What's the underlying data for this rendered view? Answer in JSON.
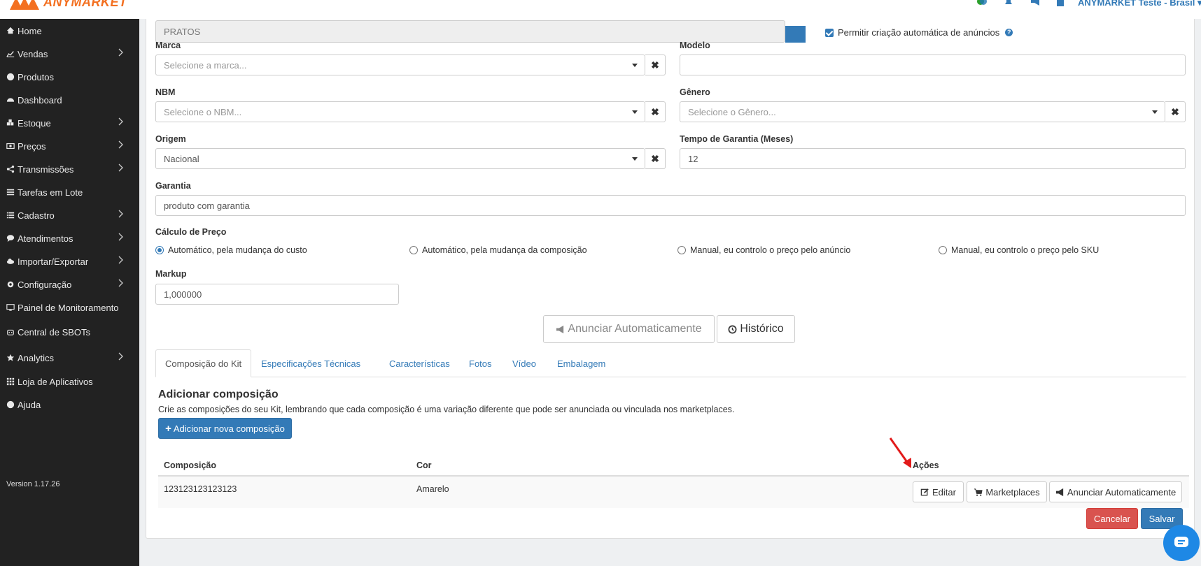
{
  "header": {
    "logo_text": "ANYMARKET",
    "account": "ANYMARKET Teste - Brasil"
  },
  "sidebar": {
    "items": [
      {
        "label": "Home",
        "icon": "home-icon",
        "has_submenu": false
      },
      {
        "label": "Vendas",
        "icon": "chart-line-icon",
        "has_submenu": true
      },
      {
        "label": "Produtos",
        "icon": "product-hunt-icon",
        "has_submenu": false
      },
      {
        "label": "Dashboard",
        "icon": "dashboard-icon",
        "has_submenu": false
      },
      {
        "label": "Estoque",
        "icon": "cubes-icon",
        "has_submenu": true
      },
      {
        "label": "Preços",
        "icon": "money-icon",
        "has_submenu": true
      },
      {
        "label": "Transmissões",
        "icon": "share-icon",
        "has_submenu": true
      },
      {
        "label": "Tarefas em Lote",
        "icon": "tasks-icon",
        "has_submenu": false
      },
      {
        "label": "Cadastro",
        "icon": "list-icon",
        "has_submenu": true
      },
      {
        "label": "Atendimentos",
        "icon": "comment-icon",
        "has_submenu": true
      },
      {
        "label": "Importar/Exportar",
        "icon": "cloud-icon",
        "has_submenu": true
      },
      {
        "label": "Configuração",
        "icon": "gear-icon",
        "has_submenu": true
      },
      {
        "label": "Painel de Monitoramento",
        "icon": "monitor-icon",
        "has_submenu": false
      },
      {
        "label": "Central de SBOTs",
        "icon": "robot-icon",
        "has_submenu": false
      },
      {
        "label": "Analytics",
        "icon": "star-icon",
        "has_submenu": true
      },
      {
        "label": "Loja de Aplicativos",
        "icon": "grid-icon",
        "has_submenu": false
      },
      {
        "label": "Ajuda",
        "icon": "question-icon",
        "has_submenu": false
      }
    ],
    "version": "Version 1.17.26"
  },
  "form": {
    "top_field_value": "PRATOS",
    "auto_ads_checkbox_label": "Permitir criação automática de anúncios",
    "marca": {
      "label": "Marca",
      "placeholder": "Selecione a marca..."
    },
    "modelo": {
      "label": "Modelo",
      "value": ""
    },
    "nbm": {
      "label": "NBM",
      "placeholder": "Selecione o NBM..."
    },
    "genero": {
      "label": "Gênero",
      "placeholder": "Selecione o Gênero..."
    },
    "origem": {
      "label": "Origem",
      "value": "Nacional"
    },
    "garantia_tempo": {
      "label": "Tempo de Garantia (Meses)",
      "value": "12"
    },
    "garantia": {
      "label": "Garantia",
      "value": "produto com garantia"
    },
    "calculo_preco": {
      "label": "Cálculo de Preço",
      "options": [
        "Automático, pela mudança do custo",
        "Automático, pela mudança da composição",
        "Manual, eu controlo o preço pelo anúncio",
        "Manual, eu controlo o preço pelo SKU"
      ],
      "selected_index": 0
    },
    "markup": {
      "label": "Markup",
      "value": "1,000000"
    }
  },
  "actions": {
    "anunciar": "Anunciar Automaticamente",
    "historico": "Histórico"
  },
  "tabs": [
    "Composição do Kit",
    "Especificações Técnicas",
    "Características",
    "Fotos",
    "Vídeo",
    "Embalagem"
  ],
  "composicao": {
    "title": "Adicionar composição",
    "description": "Crie as composições do seu Kit, lembrando que cada composição é uma variação diferente que pode ser anunciada ou vinculada nos marketplaces.",
    "add_button": "Adicionar nova composição",
    "columns": [
      "Composição",
      "Cor",
      "Ações"
    ],
    "rows": [
      {
        "composicao": "123123123123123",
        "cor": "Amarelo"
      }
    ],
    "row_actions": {
      "editar": "Editar",
      "marketplaces": "Marketplaces",
      "anunciar": "Anunciar Automaticamente"
    }
  },
  "footer": {
    "cancelar": "Cancelar",
    "salvar": "Salvar"
  },
  "colors": {
    "brand": "#f37021",
    "primary": "#337ab7",
    "danger": "#d9534f",
    "sidebar_bg": "#222222"
  }
}
